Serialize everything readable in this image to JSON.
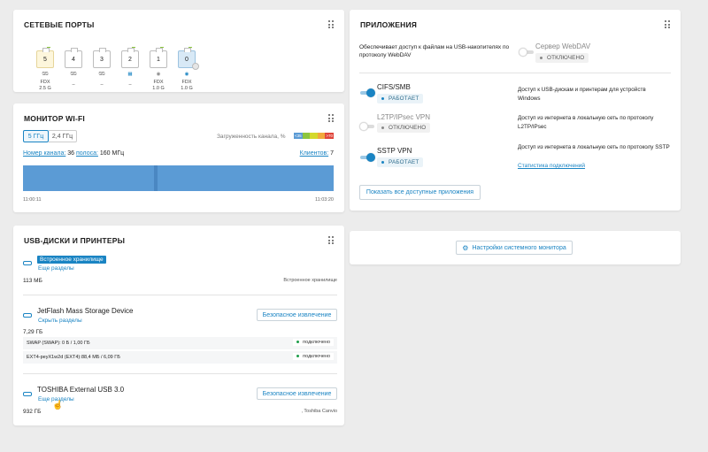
{
  "ports": {
    "title": "СЕТЕВЫЕ ПОРТЫ",
    "items": [
      {
        "num": "5",
        "label": "FDX\n2.5 G",
        "icon": "⍉⍉",
        "active": "wan"
      },
      {
        "num": "4",
        "label": "–",
        "icon": "⍉⍉",
        "active": ""
      },
      {
        "num": "3",
        "label": "–",
        "icon": "⍉⍉",
        "active": ""
      },
      {
        "num": "2",
        "label": "–",
        "icon": "▦",
        "active": ""
      },
      {
        "num": "1",
        "label": "FDX\n1.0 G",
        "icon": "◉",
        "active": ""
      },
      {
        "num": "0",
        "label": "FDX\n1.0 G",
        "icon": "◉",
        "active": "sfp"
      }
    ]
  },
  "wifi": {
    "title": "МОНИТОР WI-FI",
    "tabs": [
      "5 ГГц",
      "2,4 ГГц"
    ],
    "load_label": "Загруженность канала, %",
    "load_low": "<35",
    "load_high": ">70",
    "channel_label": "Номер канала:",
    "channel_value": "36",
    "band_label": "полоса:",
    "band_value": "160 МГц",
    "clients_label": "Клиентов:",
    "clients_value": "7",
    "time_start": "11:00:11",
    "time_end": "11:03:20"
  },
  "usb": {
    "title": "USB-ДИСКИ И ПРИНТЕРЫ",
    "builtin": {
      "name": "Встроенное хранилище",
      "more": "Еще разделы",
      "size": "113 МБ",
      "right": "Встроенное хранилище"
    },
    "devices": [
      {
        "name": "JetFlash Mass Storage Device",
        "toggle": "Скрыть разделы",
        "eject": "Безопасное извлечение",
        "size": "7,29 ГБ",
        "partitions": [
          {
            "label": "SWAP (SWAP):",
            "value": "0 Б / 1,00 ГБ",
            "status": "подключено"
          },
          {
            "label": "EXT4-peyX1w2d (EXT4):",
            "value": "88,4 МБ / 6,09 ГБ",
            "status": "подключено"
          }
        ]
      },
      {
        "name": "TOSHIBA External USB 3.0",
        "toggle": "Еще разделы",
        "eject": "Безопасное извлечение",
        "size": "932 ГБ",
        "right": ", Toshiba Canvio"
      }
    ]
  },
  "apps": {
    "title": "ПРИЛОЖЕНИЯ",
    "webdav_desc": "Обеспечивает доступ к файлам на USB-накопителях по протоколу WebDAV",
    "webdav_name": "Сервер WebDAV",
    "webdav_status": "ОТКЛЮЧЕНО",
    "items": [
      {
        "name": "CIFS/SMB",
        "status": "РАБОТАЕТ",
        "desc": "Доступ к USB-дискам и принтерам для устройств Windows",
        "on": true
      },
      {
        "name": "L2TP/IPsec VPN",
        "status": "ОТКЛЮЧЕНО",
        "desc": "Доступ из интернета в локальную сеть по протоколу L2TP/IPsec",
        "on": false
      },
      {
        "name": "SSTP VPN",
        "status": "РАБОТАЕТ",
        "desc": "Доступ из интернета в локальную сеть по протоколу SSTP",
        "on": true,
        "link": "Статистика подключений"
      }
    ],
    "show_all": "Показать все доступные приложения"
  },
  "monitor": {
    "settings": "Настройки системного монитора"
  },
  "colors": {
    "accent": "#1a84c3",
    "chart": "#5b9bd5",
    "ok": "#1d9e4a"
  }
}
